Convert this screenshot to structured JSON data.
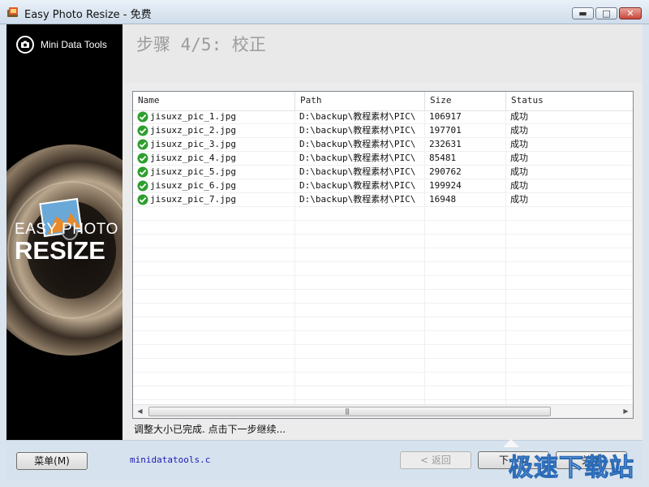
{
  "window": {
    "title": "Easy Photo Resize - 免费",
    "controls": {
      "minimize": "▬",
      "maximize": "□",
      "close": "✕"
    }
  },
  "sidebar": {
    "brand": "Mini Data Tools",
    "product_line1": "EASY PHOTO",
    "product_line2": "RESIZE"
  },
  "header": {
    "step_title": "步骤 4/5: 校正"
  },
  "table": {
    "columns": [
      "Name",
      "Path",
      "Size",
      "Status"
    ],
    "rows": [
      {
        "name": "jisuxz_pic_1.jpg",
        "path": "D:\\backup\\教程素材\\PIC\\",
        "size": "106917",
        "status": "成功"
      },
      {
        "name": "jisuxz_pic_2.jpg",
        "path": "D:\\backup\\教程素材\\PIC\\",
        "size": "197701",
        "status": "成功"
      },
      {
        "name": "jisuxz_pic_3.jpg",
        "path": "D:\\backup\\教程素材\\PIC\\",
        "size": "232631",
        "status": "成功"
      },
      {
        "name": "jisuxz_pic_4.jpg",
        "path": "D:\\backup\\教程素材\\PIC\\",
        "size": "85481",
        "status": "成功"
      },
      {
        "name": "jisuxz_pic_5.jpg",
        "path": "D:\\backup\\教程素材\\PIC\\",
        "size": "290762",
        "status": "成功"
      },
      {
        "name": "jisuxz_pic_6.jpg",
        "path": "D:\\backup\\教程素材\\PIC\\",
        "size": "199924",
        "status": "成功"
      },
      {
        "name": "jisuxz_pic_7.jpg",
        "path": "D:\\backup\\教程素材\\PIC\\",
        "size": "16948",
        "status": "成功"
      }
    ]
  },
  "status_message": "调整大小已完成. 点击下一步继续...",
  "footer": {
    "menu_label": "菜单(M)",
    "link_text": "minidatatools.c",
    "back_label": "< 返回",
    "next_label": "下一步",
    "close_label": "关闭"
  },
  "watermark": "极速下载站",
  "colors": {
    "accent_link": "#1a1ab0",
    "success_icon": "#2e9e2e",
    "header_text": "#9c9c9c"
  }
}
